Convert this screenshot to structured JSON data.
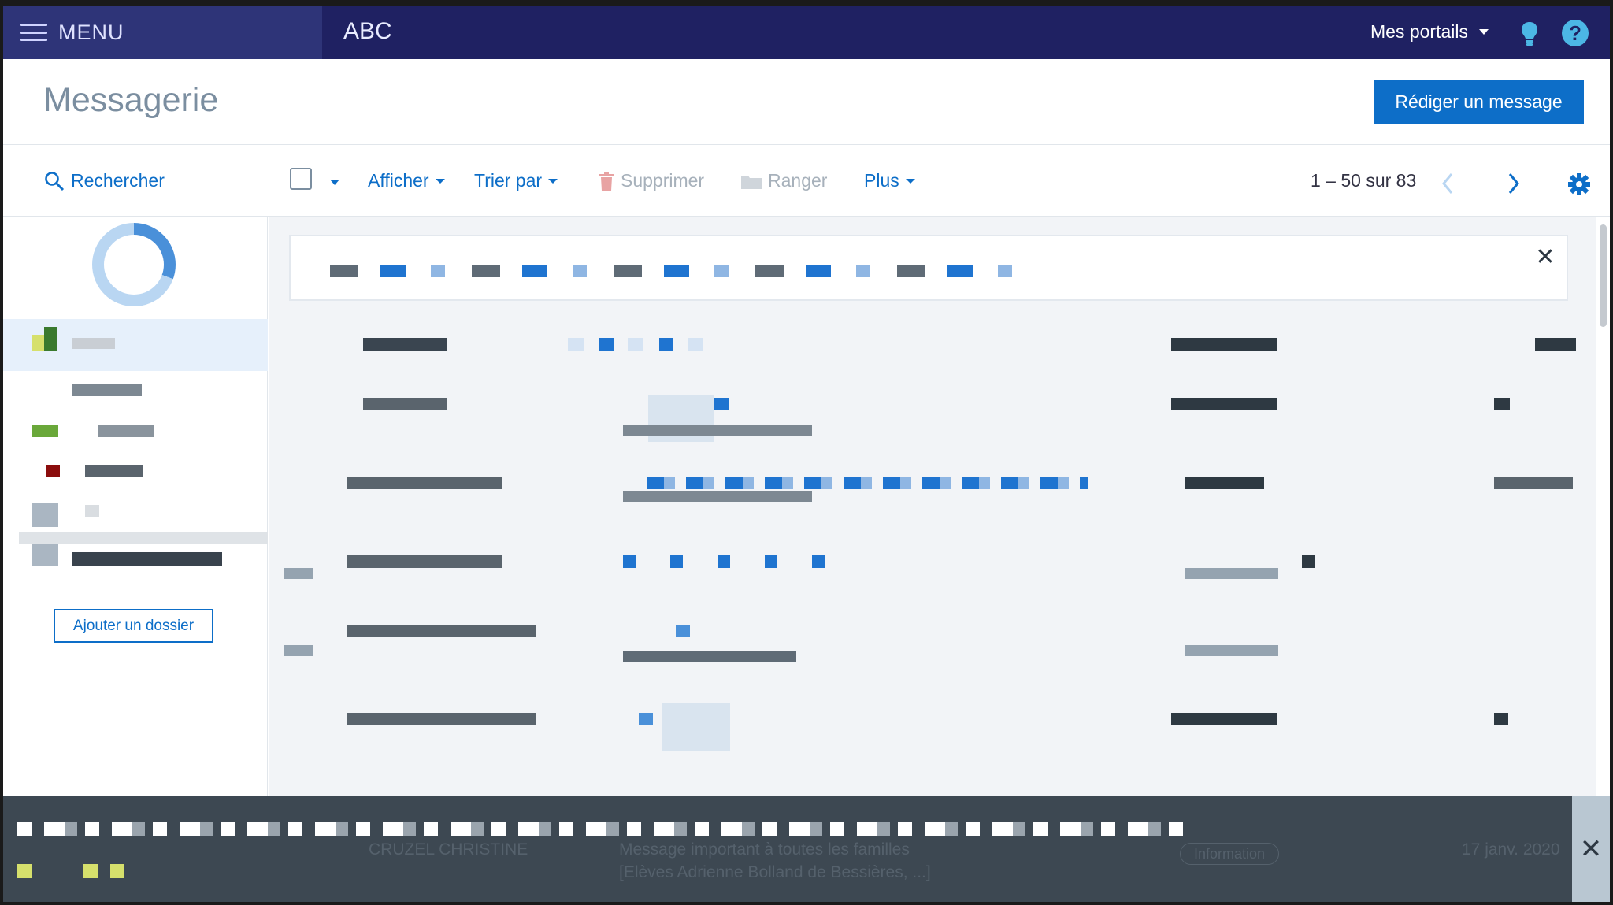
{
  "topbar": {
    "menu_label": "MENU",
    "app_title": "ABC",
    "portals_label": "Mes portails",
    "help_glyph": "?"
  },
  "header": {
    "title": "Messagerie",
    "compose_label": "Rédiger un message"
  },
  "toolbar": {
    "search_label": "Rechercher",
    "show_label": "Afficher",
    "sort_label": "Trier par",
    "delete_label": "Supprimer",
    "file_label": "Ranger",
    "more_label": "Plus",
    "pager": "1 – 50 sur 83"
  },
  "sidebar": {
    "add_folder_label": "Ajouter un dossier"
  },
  "banner": {
    "close_glyph": "✕"
  },
  "notification": {
    "close_glyph": "✕",
    "ghost_sender": "CRUZEL CHRISTINE",
    "ghost_subject": "Message important à toutes les familles",
    "ghost_recipients": "[Elèves Adrienne Bolland de Bessières, ...]",
    "ghost_badge": "Information",
    "ghost_date": "17 janv. 2020"
  },
  "colors": {
    "topbar": "#1f2162",
    "menu_block": "#2e3478",
    "accent": "#0d6ec8",
    "help": "#4cb7e5",
    "notification": "#3d4852"
  }
}
